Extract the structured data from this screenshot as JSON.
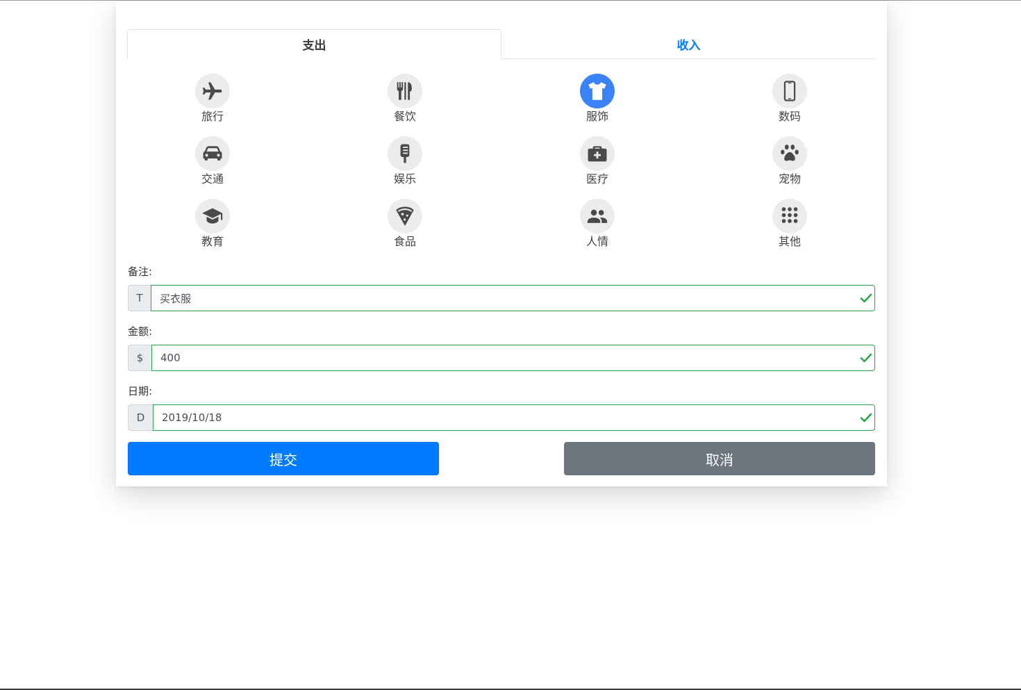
{
  "tabs": [
    {
      "label": "支出",
      "active": true
    },
    {
      "label": "收入",
      "active": false
    }
  ],
  "categories": [
    {
      "label": "旅行",
      "icon": "airplane-icon"
    },
    {
      "label": "餐饮",
      "icon": "utensils-icon"
    },
    {
      "label": "服饰",
      "icon": "tshirt-icon",
      "selected": true
    },
    {
      "label": "数码",
      "icon": "phone-icon"
    },
    {
      "label": "交通",
      "icon": "car-icon"
    },
    {
      "label": "娱乐",
      "icon": "microphone-icon"
    },
    {
      "label": "医疗",
      "icon": "medkit-icon"
    },
    {
      "label": "宠物",
      "icon": "paw-icon"
    },
    {
      "label": "教育",
      "icon": "graduation-cap-icon"
    },
    {
      "label": "食品",
      "icon": "pizza-icon"
    },
    {
      "label": "人情",
      "icon": "people-icon"
    },
    {
      "label": "其他",
      "icon": "grid-dots-icon"
    }
  ],
  "form": {
    "note": {
      "label": "备注:",
      "addon": "T",
      "value": "买衣服"
    },
    "amount": {
      "label": "金额:",
      "addon": "$",
      "value": "400"
    },
    "date": {
      "label": "日期:",
      "addon": "D",
      "value": "2019/10/18"
    }
  },
  "buttons": {
    "submit": "提交",
    "cancel": "取消"
  },
  "colors": {
    "primary": "#007bff",
    "secondary": "#6c757d",
    "valid": "#28a745",
    "selected_icon_bg": "#3b82f6",
    "icon_bg": "#ececec",
    "icon_fg": "#4a4a4a"
  }
}
